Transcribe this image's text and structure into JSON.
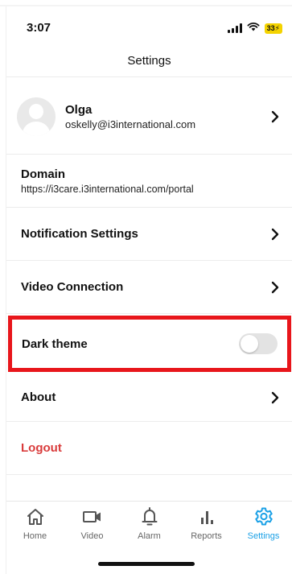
{
  "status_bar": {
    "time": "3:07",
    "battery": "33⚡"
  },
  "header": {
    "title": "Settings"
  },
  "profile": {
    "name": "Olga",
    "email": "oskelly@i3international.com"
  },
  "domain": {
    "title": "Domain",
    "url": "https://i3care.i3international.com/portal"
  },
  "menu": {
    "notification_settings": "Notification Settings",
    "video_connection": "Video Connection",
    "dark_theme": "Dark theme",
    "dark_theme_enabled": false,
    "about": "About",
    "logout": "Logout"
  },
  "tabs": [
    {
      "label": "Home",
      "icon": "home-icon"
    },
    {
      "label": "Video",
      "icon": "video-camera-icon"
    },
    {
      "label": "Alarm",
      "icon": "bell-icon"
    },
    {
      "label": "Reports",
      "icon": "bar-chart-icon"
    },
    {
      "label": "Settings",
      "icon": "gear-icon",
      "active": true
    }
  ],
  "colors": {
    "highlight_border": "#e8161b",
    "logout_text": "#d93b3b",
    "active_tab": "#1aa0e6"
  }
}
